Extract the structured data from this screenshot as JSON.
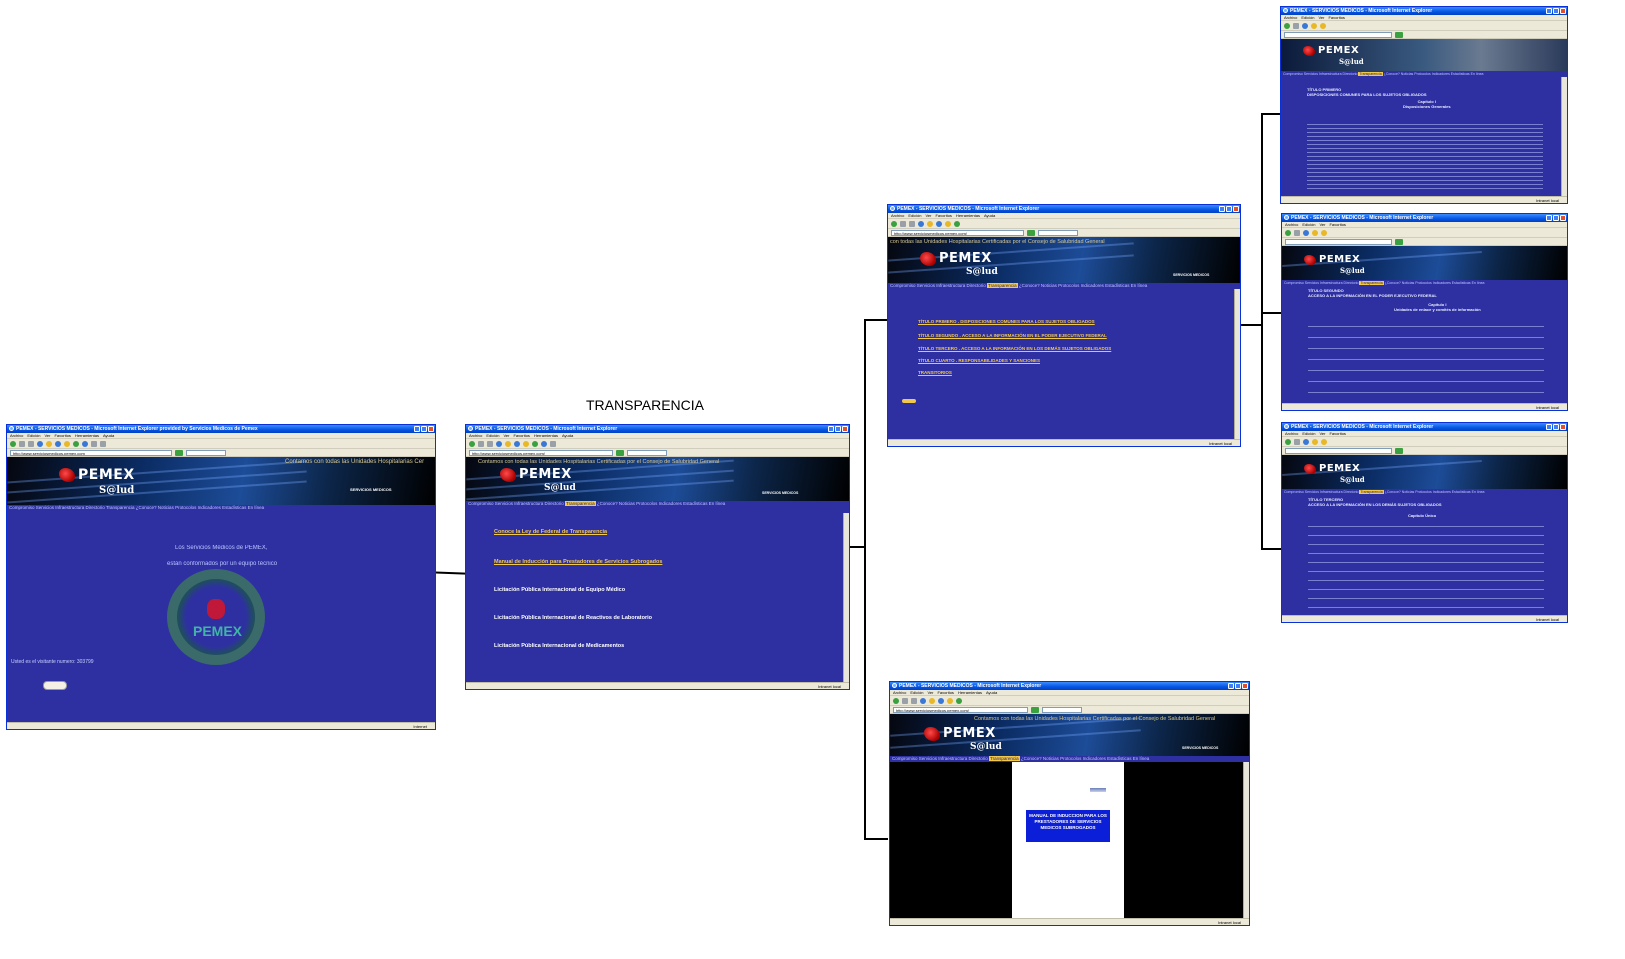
{
  "caption": "TRANSPARENCIA",
  "browser": {
    "menu": [
      "Archivo",
      "Edición",
      "Ver",
      "Favoritos",
      "Herramientas",
      "Ayuda"
    ],
    "status_internet": "Internet",
    "status_local": "Intranet local"
  },
  "window1": {
    "title": "PEMEX - SERVICIOS MEDICOS - Microsoft Internet Explorer provided by Servicios Medicos de Pemex",
    "address": "http://www.serviciosmedicos.pemex.com",
    "ticker": "Contamos con todas las Unidades Hospitalarias Cer",
    "banner_right": "SERVICIOS MEDICOS",
    "nav": "Compromiso  Servicios  Infraestructura  Directorio  Transparencia  ¿Conoce?  Noticias  Protocolos  Indicadores  Estadísticas  En línea",
    "nav_highlight": "",
    "welcome_1": "Los Servicios Médicos de PEMEX,",
    "welcome_2": "están conformados por un equipo técnico",
    "emblem_text": "PEMEX",
    "visitor": "Usted es el visitante numero: 303799",
    "status": "Internet"
  },
  "window2": {
    "title": "PEMEX - SERVICIOS MEDICOS - Microsoft Internet Explorer",
    "address": "http://www.serviciosmedicos.pemex.com/",
    "ticker": "Contamos con todas las Unidades Hospitalarias Certificadas por el Consejo de Salubridad General",
    "banner_right": "SERVICIOS MEDICOS",
    "nav_before": "Compromiso  Servicios  Infraestructura  Directorio  ",
    "nav_highlight": "Transparencia",
    "nav_after": "  ¿Conoce?  Noticias  Protocolos  Indicadores  Estadísticas  En línea",
    "links": [
      {
        "label": "Conoce la Ley de Federal de Transparencia",
        "style": "yellow"
      },
      {
        "label": "Manual de Inducción para Prestadores de Servicios Subrogados",
        "style": "yellow"
      },
      {
        "label": "Licitación Pública Internacional de Equipo Médico",
        "style": "white"
      },
      {
        "label": "Licitación Pública Internacional de Reactivos de Laboratorio",
        "style": "white"
      },
      {
        "label": "Licitación Pública Internacional de Medicamentos",
        "style": "white"
      }
    ],
    "status": "Intranet local"
  },
  "window3": {
    "title": "PEMEX - SERVICIOS MEDICOS - Microsoft Internet Explorer",
    "address": "http://www.serviciosmedicos.pemex.com/",
    "ticker": "con todas las Unidades Hospitalarias Certificadas por el Consejo de Salubridad General",
    "banner_right": "SERVICIOS MEDICOS",
    "links": [
      "TÍTULO PRIMERO . DISPOSICIONES COMUNES PARA LOS SUJETOS OBLIGADOS",
      "TÍTULO SEGUNDO . ACCESO A LA INFORMACIÓN EN EL PODER EJECUTIVO FEDERAL",
      "TÍTULO TERCERO . ACCESO A LA INFORMACIÓN EN LOS DEMÁS SUJETOS OBLIGADOS",
      "TÍTULO CUARTO . RESPONSABILIDADES Y SANCIONES",
      "TRANSITORIOS"
    ],
    "status": "Intranet local"
  },
  "window4": {
    "title": "PEMEX - SERVICIOS MEDICOS - Microsoft Internet Explorer",
    "address": "http://www.serviciosmedicos.pemex.com/",
    "ticker": "Contamos con todas las Unidades Hospitalarias Certificadas por el Consejo de Salubridad General",
    "banner_right": "SERVICIOS MEDICOS",
    "doc_title": "MANUAL DE INDUCCION PARA LOS PRESTADORES DE SERVICIOS MEDICOS SUBROGADOS",
    "status": "Intranet local"
  },
  "window5": {
    "title": "PEMEX - SERVICIOS MEDICOS - Microsoft Internet Explorer",
    "heading": "TÍTULO PRIMERO\nDISPOSICIONES COMUNES PARA LOS SUJETOS OBLIGADOS",
    "chapter": "Capítulo I\nDisposiciones Generales",
    "status": "Intranet local"
  },
  "window6": {
    "title": "PEMEX - SERVICIOS MEDICOS - Microsoft Internet Explorer",
    "heading": "TÍTULO SEGUNDO\nACCESO A LA INFORMACIÓN EN EL PODER EJECUTIVO FEDERAL",
    "chapter": "Capítulo I\nUnidades de enlace y comités de información",
    "status": "Intranet local"
  },
  "window7": {
    "title": "PEMEX - SERVICIOS MEDICOS - Microsoft Internet Explorer",
    "heading": "TÍTULO TERCERO\nACCESO A LA INFORMACIÓN EN LOS DEMÁS SUJETOS OBLIGADOS",
    "chapter": "Capítulo Único",
    "status": "Intranet local"
  },
  "colors": {
    "page_blue": "#2e30a2",
    "link_yellow": "#f2c84a",
    "xp_title": "#0554e3"
  }
}
